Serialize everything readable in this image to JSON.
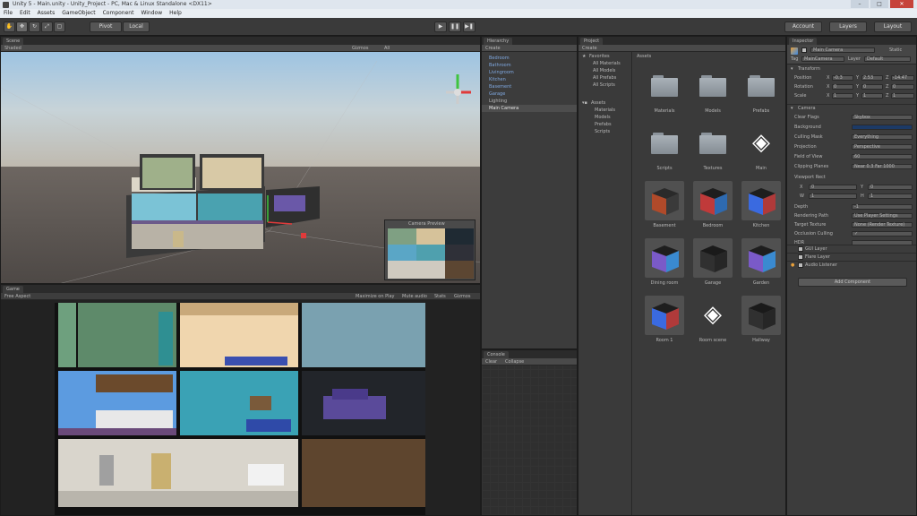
{
  "window": {
    "title": "Unity 5 - Main.unity - Unity_Project - PC, Mac & Linux Standalone <DX11>",
    "buttons": [
      "–",
      "□",
      "✕"
    ]
  },
  "menu": [
    "File",
    "Edit",
    "Assets",
    "GameObject",
    "Component",
    "Window",
    "Help"
  ],
  "toolbar": {
    "tools": [
      "hand-tool",
      "move-tool",
      "rotate-tool",
      "scale-tool",
      "rect-tool"
    ],
    "pivot_label": "Pivot",
    "space_label": "Local",
    "play": "▶",
    "pause": "❚❚",
    "step": "▶❚",
    "right_buttons": [
      "Account",
      "Layers",
      "Layout"
    ]
  },
  "scene": {
    "tab": "Scene",
    "shading": "Shaded",
    "gizmos": "Gizmos",
    "search": "All",
    "camera_preview_title": "Camera Preview"
  },
  "game": {
    "tab": "Game",
    "aspect": "Free Aspect",
    "options": [
      "Maximize on Play",
      "Mute audio",
      "Stats",
      "Gizmos"
    ]
  },
  "hierarchy": {
    "tab": "Hierarchy",
    "create": "Create",
    "items": [
      "Bedroom",
      "Bathroom",
      "Livingroom",
      "Kitchen",
      "Basement",
      "Garage",
      "Lighting",
      "Main Camera"
    ],
    "selected_index": 7
  },
  "project": {
    "tab": "Project",
    "create": "Create",
    "favorites_label": "Favorites",
    "favorites": [
      "All Materials",
      "All Models",
      "All Prefabs",
      "All Scripts"
    ],
    "assets_label": "Assets",
    "asset_tree": [
      "Materials",
      "Models",
      "Prefabs",
      "Scripts"
    ],
    "breadcrumb": "Assets",
    "grid": [
      {
        "name": "Materials",
        "kind": "folder"
      },
      {
        "name": "Models",
        "kind": "folder"
      },
      {
        "name": "Prefabs",
        "kind": "folder"
      },
      {
        "name": "Scripts",
        "kind": "folder"
      },
      {
        "name": "Textures",
        "kind": "folder"
      },
      {
        "name": "Main",
        "kind": "unity"
      },
      {
        "name": "Basement",
        "kind": "cube-warm"
      },
      {
        "name": "Bedroom",
        "kind": "cube-red"
      },
      {
        "name": "Kitchen",
        "kind": "cube-blue"
      },
      {
        "name": "Dining room",
        "kind": "cube-violet"
      },
      {
        "name": "Garage",
        "kind": "cube-dark"
      },
      {
        "name": "Garden",
        "kind": "cube-violet"
      },
      {
        "name": "Room 1",
        "kind": "cube-blue"
      },
      {
        "name": "Room scene",
        "kind": "unity"
      },
      {
        "name": "Hallway",
        "kind": "cube-dark"
      }
    ]
  },
  "console": {
    "tab": "Console",
    "buttons": [
      "Clear",
      "Collapse"
    ]
  },
  "inspector": {
    "tab": "Inspector",
    "object_name": "Main Camera",
    "static_label": "Static",
    "tag_label": "Tag",
    "tag_value": "MainCamera",
    "layer_label": "Layer",
    "layer_value": "Default",
    "transform": {
      "title": "Transform",
      "rows": [
        {
          "label": "Position",
          "x": "-0.3",
          "y": "2.53",
          "z": "-14.47"
        },
        {
          "label": "Rotation",
          "x": "0",
          "y": "0",
          "z": "0"
        },
        {
          "label": "Scale",
          "x": "1",
          "y": "1",
          "z": "1"
        }
      ]
    },
    "camera": {
      "title": "Camera",
      "rows": [
        {
          "label": "Clear Flags",
          "value": "Skybox"
        },
        {
          "label": "Background",
          "value": ""
        },
        {
          "label": "Culling Mask",
          "value": "Everything"
        },
        {
          "label": "Projection",
          "value": "Perspective"
        },
        {
          "label": "Field of View",
          "value": "60"
        },
        {
          "label": "Clipping Planes",
          "value": "Near 0.3   Far 1000"
        }
      ]
    },
    "viewport": {
      "title": "Viewport Rect",
      "rows": [
        {
          "label": "X",
          "v1": "0",
          "label2": "Y",
          "v2": "0"
        },
        {
          "label": "W",
          "v1": "1",
          "label2": "H",
          "v2": "1"
        }
      ]
    },
    "camera_more": [
      {
        "label": "Depth",
        "value": "-1"
      },
      {
        "label": "Rendering Path",
        "value": "Use Player Settings"
      },
      {
        "label": "Target Texture",
        "value": "None (Render Texture)"
      },
      {
        "label": "Occlusion Culling",
        "value": "✓"
      },
      {
        "label": "HDR",
        "value": ""
      }
    ],
    "components": [
      "GUI Layer",
      "Flare Layer",
      "Audio Listener"
    ],
    "add_component": "Add Component"
  },
  "colors": {
    "panel": "#3c3c3c",
    "selected": "#3e6b9e",
    "accent": "#5b8cc8"
  }
}
